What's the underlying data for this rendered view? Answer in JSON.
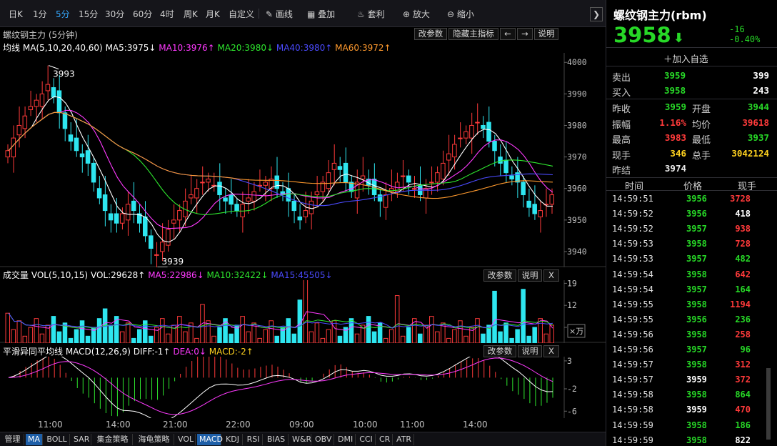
{
  "toolbar": {
    "items": [
      "日K",
      "1分",
      "5分",
      "15分",
      "30分",
      "60分",
      "4时",
      "周K",
      "月K",
      "自定义",
      "画线",
      "叠加",
      "套利",
      "放大",
      "缩小"
    ],
    "active_index": 2
  },
  "kline": {
    "title": "螺纹钢主力 (5分钟)",
    "buttons": [
      "改参数",
      "隐藏主指标",
      "←",
      "→",
      "说明"
    ],
    "ma_label": "均线",
    "ma_params": "MA(5,10,20,40,60)",
    "ma5": "MA5:3975↓",
    "ma10": "MA10:3976↑",
    "ma20": "MA20:3980↓",
    "ma40": "MA40:3980↑",
    "ma60": "MA60:3972↑",
    "high_mark": "3993",
    "low_mark": "3939",
    "y_labels": [
      "4000",
      "3990",
      "3980",
      "3970",
      "3960",
      "3950",
      "3940"
    ]
  },
  "volume": {
    "title": "成交量 VOL(5,10,15)",
    "vol": "VOL:29628↑",
    "ma5": "MA5:22986↓",
    "ma10": "MA10:32422↓",
    "ma15": "MA15:45505↓",
    "buttons": [
      "改参数",
      "说明",
      "X"
    ],
    "y_labels": [
      "19",
      "12",
      "5"
    ],
    "unit": "×万"
  },
  "macd": {
    "title": "平滑异同平均线 MACD(12,26,9)",
    "diff": "DIFF:-1↑",
    "dea": "DEA:0↓",
    "macd": "MACD:-2↑",
    "buttons": [
      "改参数",
      "说明",
      "X"
    ],
    "y_labels": [
      "3",
      "-2",
      "-6"
    ]
  },
  "x_labels": [
    "11:00",
    "14:00",
    "21:00",
    "22:00",
    "09:00",
    "10:00",
    "11:00",
    "14:00"
  ],
  "bottom_tabs": [
    "管理",
    "MA",
    "BOLL",
    "SAR",
    "集金策略",
    "海龟策略",
    "VOL",
    "MACD",
    "KDJ",
    "RSI",
    "BIAS",
    "W&R",
    "OBV",
    "DMI",
    "CCI",
    "CR",
    "ATR"
  ],
  "right": {
    "title": "螺纹钢主力(rbm)",
    "price": "3958",
    "change": "-16",
    "change_pct": "-0.40%",
    "add_watch": "加入自选",
    "sell_label": "卖出",
    "sell_price": "3959",
    "sell_qty": "399",
    "buy_label": "买入",
    "buy_price": "3958",
    "buy_qty": "243",
    "stats": [
      {
        "l1": "昨收",
        "v1": "3959",
        "c1": "#27d827",
        "l2": "开盘",
        "v2": "3944",
        "c2": "#27d827"
      },
      {
        "l1": "振幅",
        "v1": "1.16%",
        "c1": "#ff3a3a",
        "l2": "均价",
        "v2": "39618",
        "c2": "#ff3a3a"
      },
      {
        "l1": "最高",
        "v1": "3983",
        "c1": "#ff3a3a",
        "l2": "最低",
        "v2": "3937",
        "c2": "#27d827"
      },
      {
        "l1": "现手",
        "v1": "346",
        "c1": "#ffd21f",
        "l2": "总手",
        "v2": "3042124",
        "c2": "#ffd21f"
      },
      {
        "l1": "昨结",
        "v1": "3974",
        "c1": "#e8e8e8",
        "l2": "",
        "v2": "",
        "c2": "#e8e8e8"
      }
    ],
    "trade_headers": [
      "时间",
      "价格",
      "现手"
    ],
    "trades": [
      {
        "time": "14:59:51",
        "price": "3956",
        "pc": "#27d827",
        "qty": "3728",
        "qc": "#ff3a3a"
      },
      {
        "time": "14:59:52",
        "price": "3956",
        "pc": "#27d827",
        "qty": "418",
        "qc": "#ffffff"
      },
      {
        "time": "14:59:52",
        "price": "3957",
        "pc": "#27d827",
        "qty": "938",
        "qc": "#ff3a3a"
      },
      {
        "time": "14:59:53",
        "price": "3958",
        "pc": "#27d827",
        "qty": "728",
        "qc": "#ff3a3a"
      },
      {
        "time": "14:59:53",
        "price": "3957",
        "pc": "#27d827",
        "qty": "482",
        "qc": "#27d827"
      },
      {
        "time": "14:59:54",
        "price": "3958",
        "pc": "#27d827",
        "qty": "642",
        "qc": "#ff3a3a"
      },
      {
        "time": "14:59:54",
        "price": "3957",
        "pc": "#27d827",
        "qty": "164",
        "qc": "#27d827"
      },
      {
        "time": "14:59:55",
        "price": "3958",
        "pc": "#27d827",
        "qty": "1194",
        "qc": "#ff3a3a"
      },
      {
        "time": "14:59:55",
        "price": "3956",
        "pc": "#27d827",
        "qty": "236",
        "qc": "#27d827"
      },
      {
        "time": "14:59:56",
        "price": "3958",
        "pc": "#27d827",
        "qty": "258",
        "qc": "#ff3a3a"
      },
      {
        "time": "14:59:56",
        "price": "3957",
        "pc": "#27d827",
        "qty": "96",
        "qc": "#27d827"
      },
      {
        "time": "14:59:57",
        "price": "3958",
        "pc": "#27d827",
        "qty": "312",
        "qc": "#ff3a3a"
      },
      {
        "time": "14:59:57",
        "price": "3959",
        "pc": "#ffffff",
        "qty": "372",
        "qc": "#ff3a3a"
      },
      {
        "time": "14:59:58",
        "price": "3958",
        "pc": "#27d827",
        "qty": "864",
        "qc": "#27d827"
      },
      {
        "time": "14:59:58",
        "price": "3959",
        "pc": "#ffffff",
        "qty": "470",
        "qc": "#ff3a3a"
      },
      {
        "time": "14:59:59",
        "price": "3958",
        "pc": "#27d827",
        "qty": "186",
        "qc": "#27d827"
      },
      {
        "time": "14:59:59",
        "price": "3958",
        "pc": "#27d827",
        "qty": "822",
        "qc": "#ffffff"
      }
    ]
  },
  "colors": {
    "up": "#ff3a3a",
    "down": "#2ee6f0",
    "ma5": "#ffffff",
    "ma10": "#ff3aff",
    "ma20": "#2ee62e",
    "ma40": "#4b4bff",
    "ma60": "#ff9a2e",
    "accent": "#35a9ff"
  },
  "chart_data": {
    "type": "candlestick",
    "title": "螺纹钢主力 (5分钟)",
    "ylim": [
      3935,
      4003
    ],
    "ma_last": {
      "MA5": 3975,
      "MA10": 3976,
      "MA20": 3980,
      "MA40": 3980,
      "MA60": 3972
    },
    "close_series": [
      3972,
      3976,
      3980,
      3983,
      3986,
      3988,
      3990,
      3993,
      3989,
      3984,
      3979,
      3975,
      3972,
      3970,
      3968,
      3962,
      3957,
      3953,
      3950,
      3949,
      3952,
      3955,
      3953,
      3949,
      3945,
      3941,
      3939,
      3943,
      3947,
      3950,
      3953,
      3956,
      3958,
      3960,
      3962,
      3963,
      3961,
      3958,
      3956,
      3955,
      3953,
      3955,
      3957,
      3959,
      3961,
      3962,
      3963,
      3960,
      3958,
      3956,
      3953,
      3950,
      3953,
      3956,
      3959,
      3962,
      3965,
      3968,
      3966,
      3962,
      3959,
      3962,
      3964,
      3961,
      3958,
      3956,
      3958,
      3960,
      3962,
      3964,
      3962,
      3960,
      3958,
      3960,
      3962,
      3965,
      3968,
      3971,
      3974,
      3976,
      3978,
      3980,
      3981,
      3979,
      3975,
      3972,
      3968,
      3965,
      3963,
      3962,
      3958,
      3954,
      3952,
      3953,
      3955,
      3958
    ],
    "volume_ticks": [
      19,
      12,
      5
    ],
    "macd_ticks": [
      3,
      -2,
      -6
    ]
  }
}
